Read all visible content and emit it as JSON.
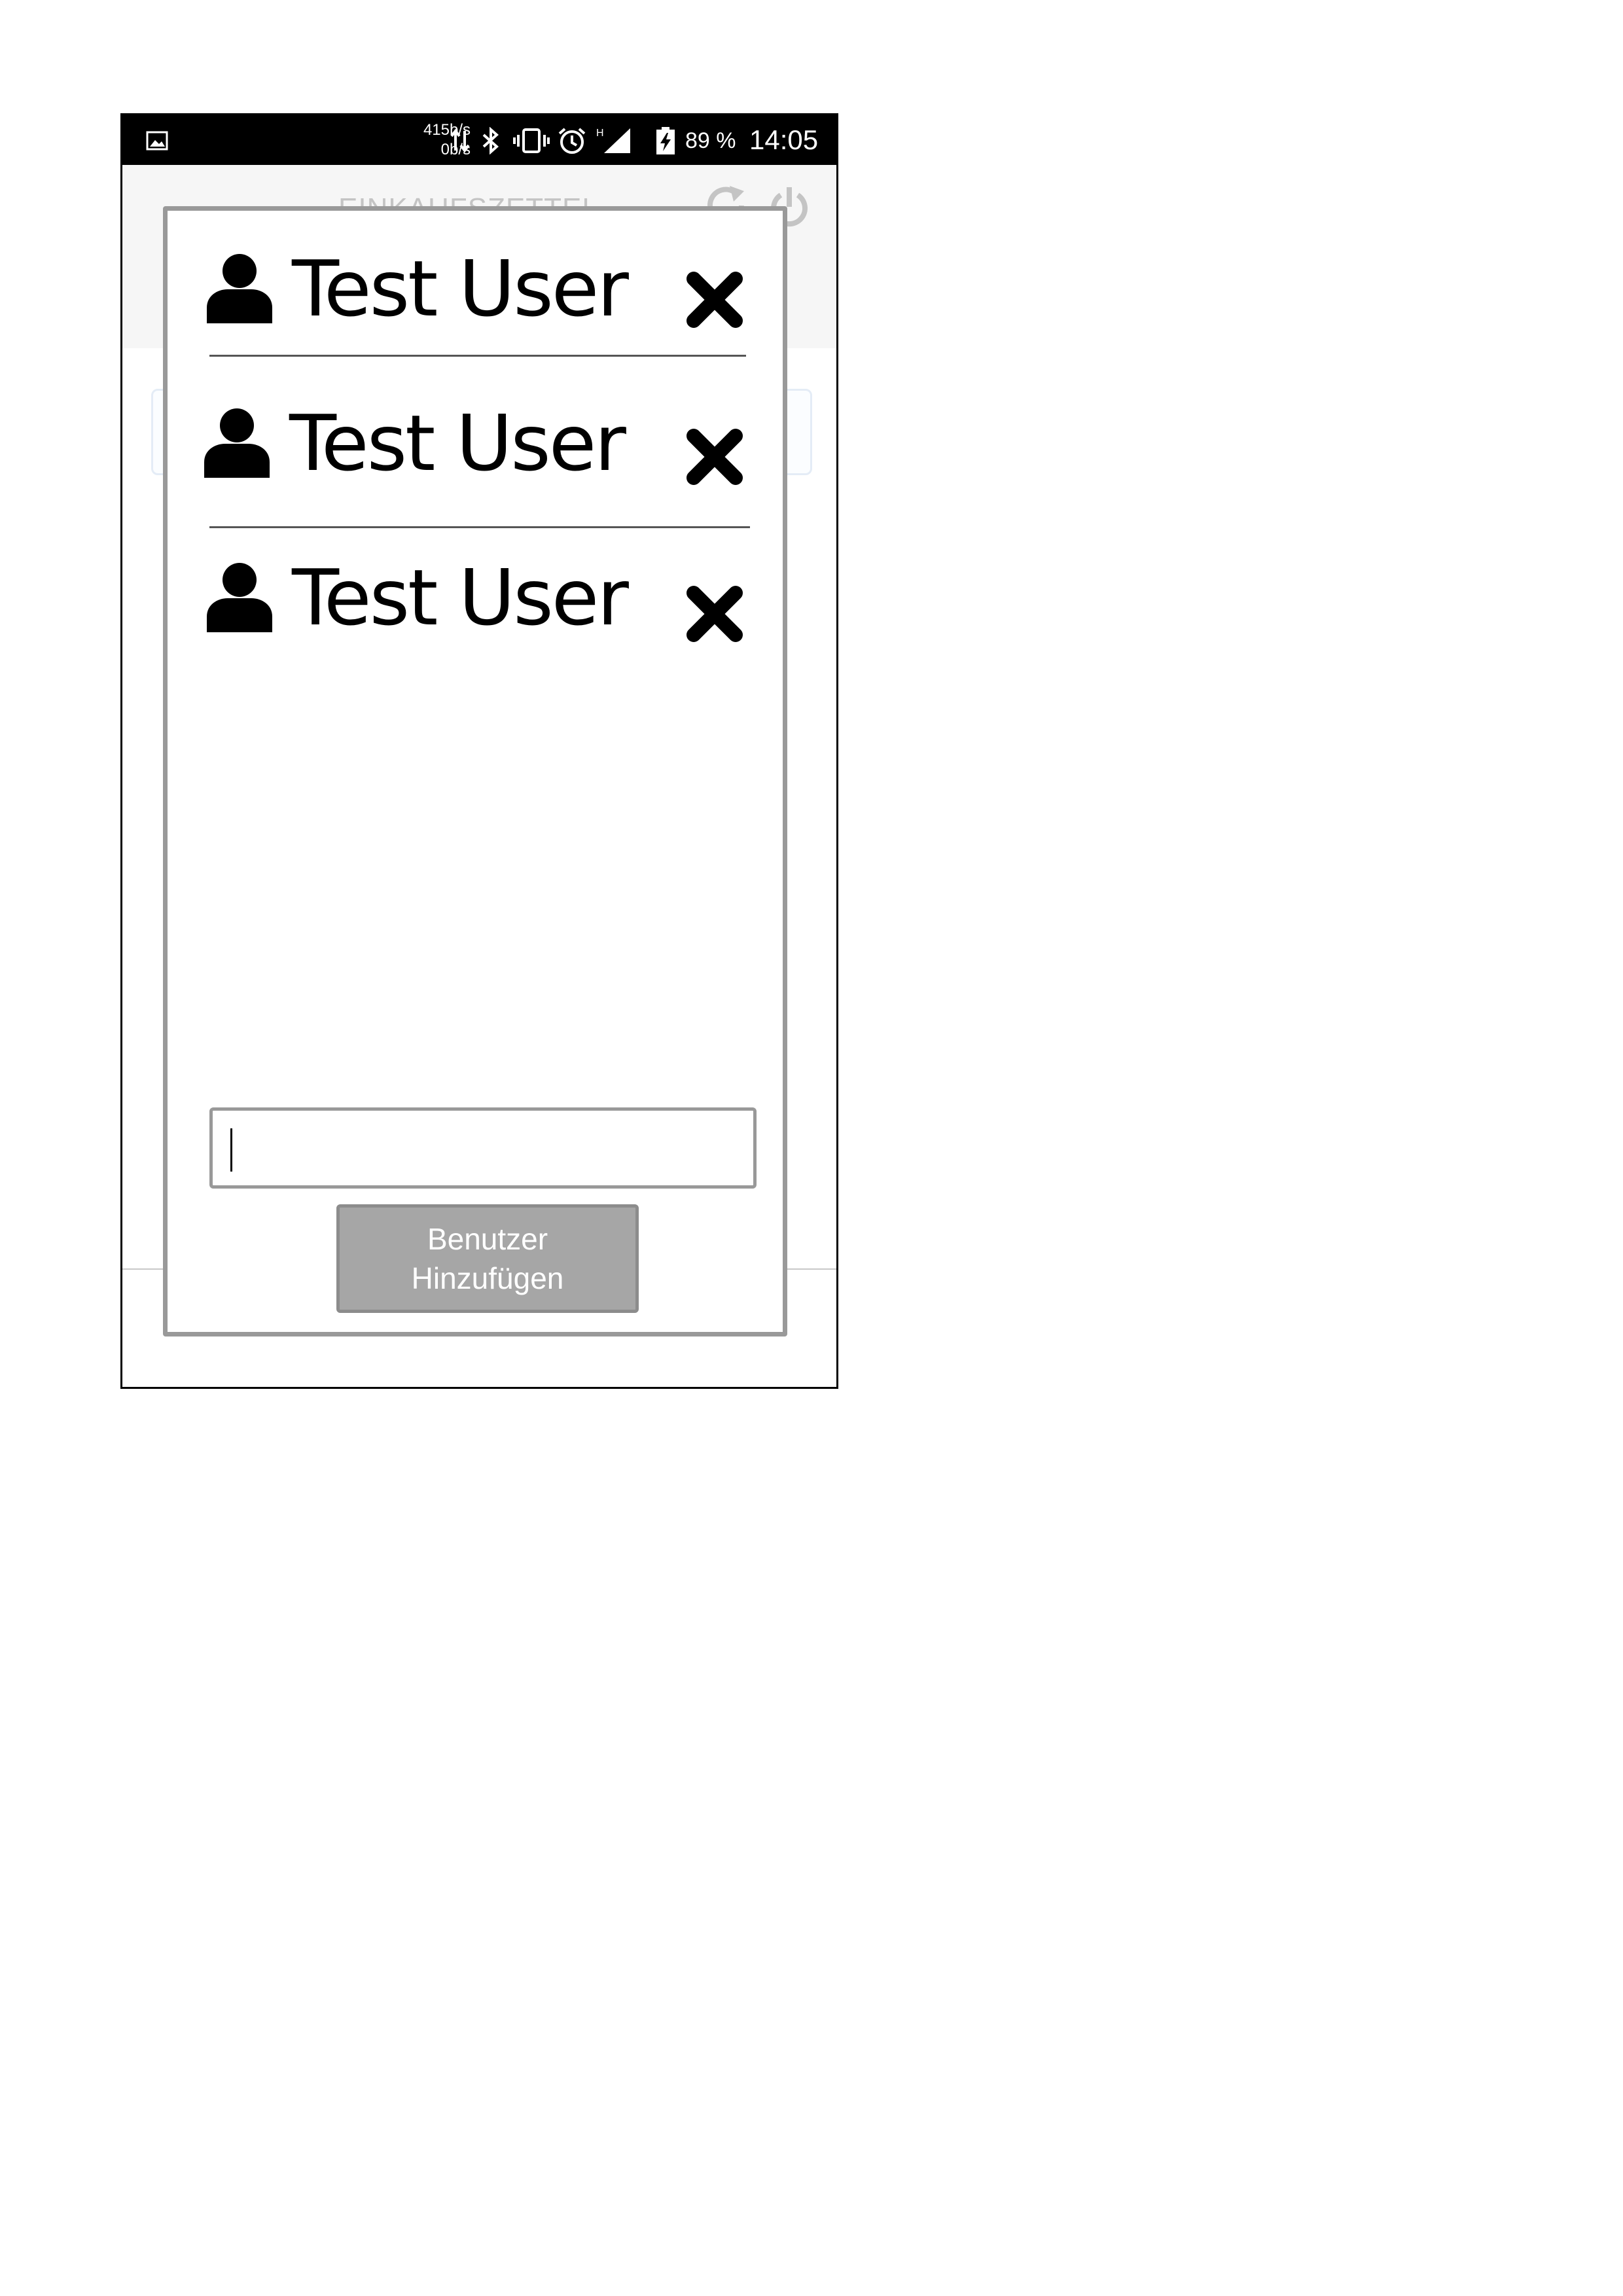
{
  "status_bar": {
    "net_up": "415b/s",
    "net_down": "0b/s",
    "battery": "89 %",
    "time": "14:05",
    "network_type": "H",
    "icons": [
      "gallery-icon",
      "data-transfer-icon",
      "bluetooth-icon",
      "vibrate-icon",
      "alarm-icon",
      "signal-icon",
      "battery-charging-icon"
    ]
  },
  "background_app": {
    "title": "EINKAUFSZETTEL",
    "icons": [
      "refresh-icon",
      "power-icon"
    ]
  },
  "dialog": {
    "users": [
      {
        "name": "Test User"
      },
      {
        "name": "Test User"
      },
      {
        "name": "Test User"
      }
    ],
    "input": {
      "value": "",
      "placeholder": ""
    },
    "add_button": {
      "line1": "Benutzer",
      "line2": "Hinzufügen"
    }
  },
  "colors": {
    "status_bar_bg": "#000000",
    "dialog_border": "#999999",
    "button_bg": "#a6a6a6",
    "button_text": "#ffffff"
  }
}
